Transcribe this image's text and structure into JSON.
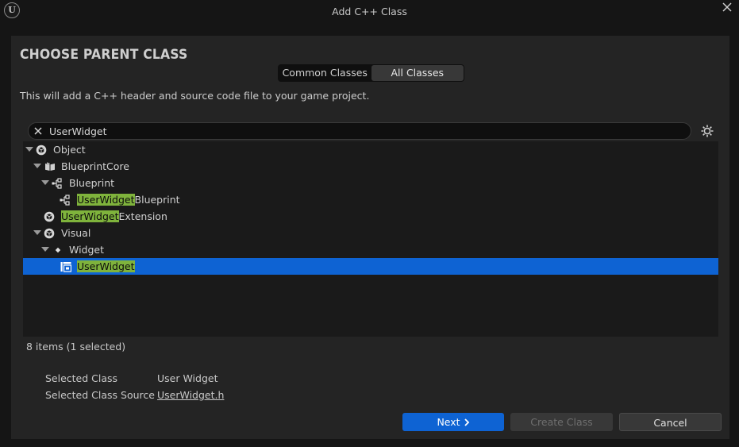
{
  "window": {
    "title": "Add C++ Class",
    "logo_text": "U"
  },
  "heading": "CHOOSE PARENT CLASS",
  "tabs": [
    {
      "label": "Common Classes",
      "active": false
    },
    {
      "label": "All Classes",
      "active": true
    }
  ],
  "description": "This will add a C++ header and source code file to your game project.",
  "search": {
    "value": "UserWidget",
    "placeholder": ""
  },
  "tree": {
    "object": {
      "label": "Object",
      "icon": "object-icon"
    },
    "blueprint_core": {
      "label": "BlueprintCore",
      "icon": "book-icon"
    },
    "blueprint": {
      "label": "Blueprint",
      "icon": "class-hierarchy-icon"
    },
    "user_widget_blueprint": {
      "match": "UserWidget",
      "rest": "Blueprint",
      "icon": "class-hierarchy-icon"
    },
    "user_widget_extension": {
      "match": "UserWidget",
      "rest": "Extension",
      "icon": "object-icon"
    },
    "visual": {
      "label": "Visual",
      "icon": "object-icon"
    },
    "widget": {
      "label": "Widget",
      "icon": "diamond-icon"
    },
    "user_widget": {
      "match": "UserWidget",
      "rest": "",
      "icon": "user-widget-icon",
      "selected": true
    }
  },
  "status": "8 items (1 selected)",
  "selected_class": {
    "label": "Selected Class",
    "value": "User Widget"
  },
  "selected_class_source": {
    "label": "Selected Class Source",
    "value": "UserWidget.h"
  },
  "buttons": {
    "next": "Next",
    "create": "Create Class",
    "cancel": "Cancel"
  },
  "colors": {
    "accent": "#0e63d3",
    "match_highlight": "#7fb33c",
    "panel": "#242424",
    "background": "#151515"
  }
}
